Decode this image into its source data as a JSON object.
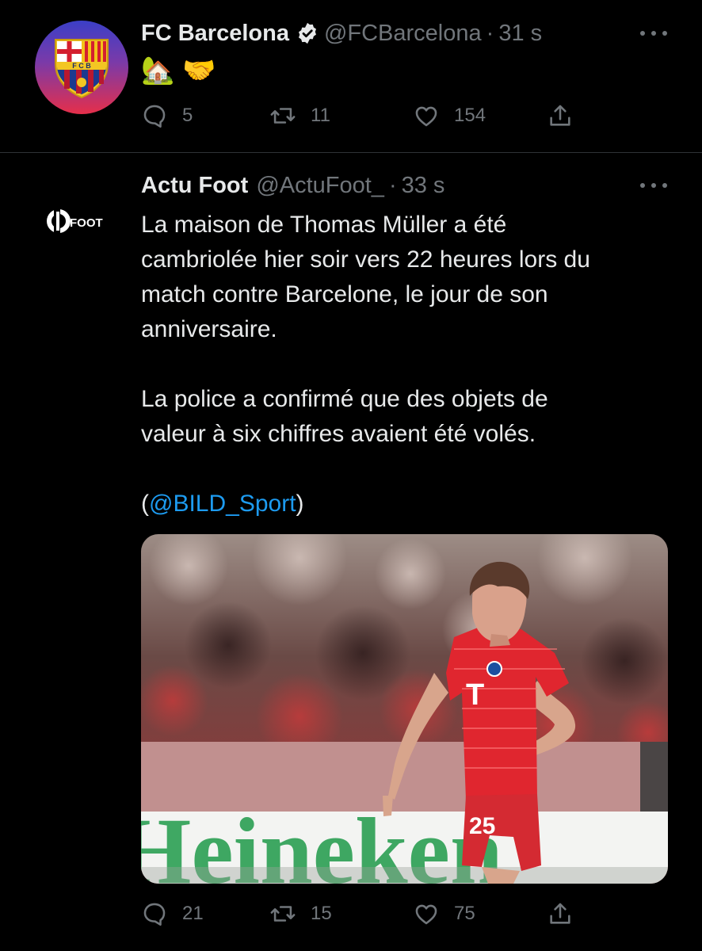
{
  "tweets": [
    {
      "display_name": "FC Barcelona",
      "handle": "@FCBarcelona",
      "separator": "·",
      "time": "31 s",
      "verified": true,
      "avatar_icon": "fc-barcelona-crest",
      "emojis": [
        "🏡",
        "🤝"
      ],
      "stats": {
        "replies": "5",
        "retweets": "11",
        "likes": "154"
      }
    },
    {
      "display_name": "Actu Foot",
      "handle": "@ActuFoot_",
      "separator": "·",
      "time": "33 s",
      "avatar_text": "FOOT",
      "text_lines": [
        "La maison de Thomas Müller a été",
        "cambriolée hier soir vers 22 heures lors du",
        "match contre Barcelone, le jour de son",
        "anniversaire.",
        "",
        "La police a confirmé que des objets de",
        "valeur à six chiffres avaient été volés.",
        ""
      ],
      "mention_prefix": "(",
      "mention": "@BILD_Sport",
      "mention_suffix": ")",
      "media": {
        "kind": "photo",
        "jersey_number": "25",
        "banner_text": "Heineken"
      },
      "stats": {
        "replies": "21",
        "retweets": "15",
        "likes": "75"
      }
    }
  ],
  "colors": {
    "background": "#000000",
    "text": "#e7e9ea",
    "secondary": "#71767b",
    "link": "#1d9bf0",
    "divider": "#2f3336"
  }
}
